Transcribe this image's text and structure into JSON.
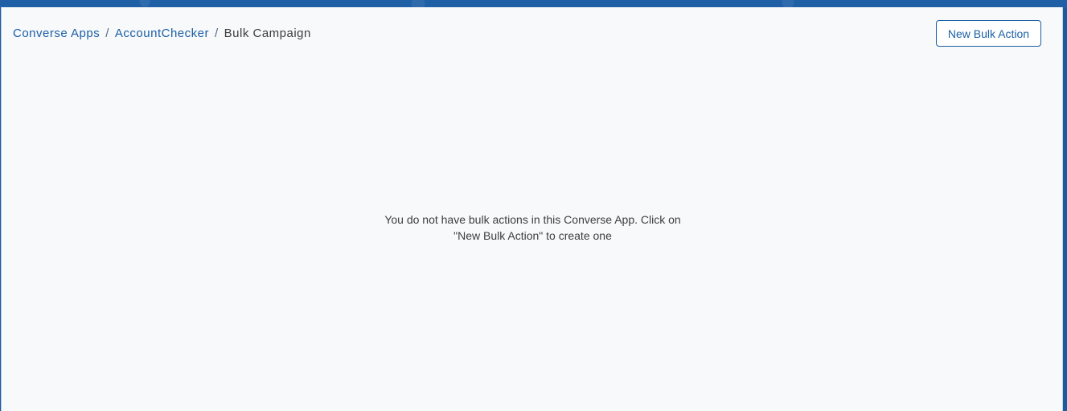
{
  "breadcrumb": {
    "items": [
      {
        "label": "Converse Apps"
      },
      {
        "label": "AccountChecker"
      }
    ],
    "separator": "/",
    "current": "Bulk Campaign"
  },
  "header": {
    "new_bulk_action_label": "New Bulk Action"
  },
  "empty_state": {
    "line1": "You do not have bulk actions in this Converse App. Click on",
    "line2": "\"New Bulk Action\" to create one"
  },
  "colors": {
    "brand_band": "#1f5fa6",
    "link": "#1b5fa3",
    "panel_bg": "#f7f9fb",
    "text": "#3e3e3c"
  }
}
